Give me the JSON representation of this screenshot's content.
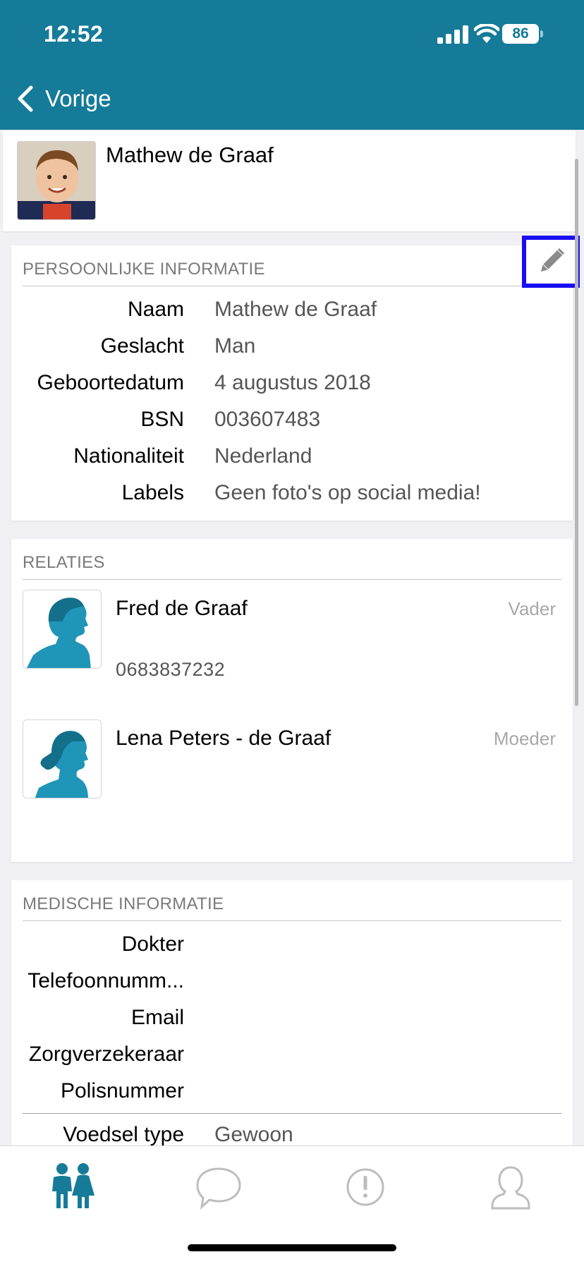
{
  "status_bar": {
    "time": "12:52",
    "battery": "86"
  },
  "nav": {
    "back_label": "Vorige"
  },
  "child": {
    "name": "Mathew de Graaf"
  },
  "personal_info": {
    "header": "PERSOONLIJKE INFORMATIE",
    "rows": [
      {
        "label": "Naam",
        "value": "Mathew de Graaf"
      },
      {
        "label": "Geslacht",
        "value": "Man"
      },
      {
        "label": "Geboortedatum",
        "value": "4 augustus 2018"
      },
      {
        "label": "BSN",
        "value": "003607483"
      },
      {
        "label": "Nationaliteit",
        "value": "Nederland"
      },
      {
        "label": "Labels",
        "value": "Geen foto's op social media!"
      }
    ]
  },
  "relations": {
    "header": "RELATIES",
    "items": [
      {
        "name": "Fred de Graaf",
        "role": "Vader",
        "phone": "0683837232"
      },
      {
        "name": "Lena Peters - de Graaf",
        "role": "Moeder"
      }
    ]
  },
  "medical_info": {
    "header": "MEDISCHE INFORMATIE",
    "rows": [
      {
        "label": "Dokter",
        "value": ""
      },
      {
        "label": "Telefoonnumm...",
        "value": ""
      },
      {
        "label": "Email",
        "value": ""
      },
      {
        "label": "Zorgverzekeraar",
        "value": ""
      },
      {
        "label": "Polisnummer",
        "value": ""
      }
    ],
    "food_row": {
      "label": "Voedsel type",
      "value": "Gewoon"
    }
  },
  "tabs": [
    {
      "name": "children-icon",
      "active": true
    },
    {
      "name": "chat-icon",
      "active": false
    },
    {
      "name": "alert-icon",
      "active": false
    },
    {
      "name": "profile-icon",
      "active": false
    }
  ],
  "colors": {
    "primary": "#157b99",
    "accent_avatar": "#1f95b8",
    "highlight": "#1a0cf5"
  }
}
